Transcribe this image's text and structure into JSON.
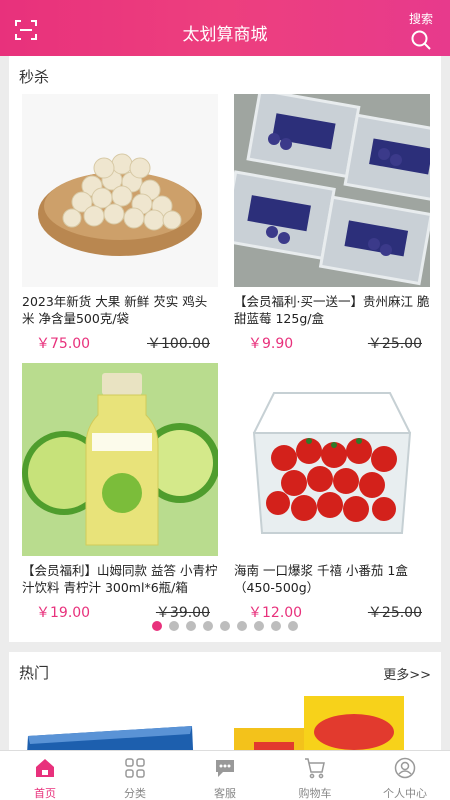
{
  "header": {
    "title": "太划算商城",
    "search_label": "搜索",
    "scan_icon": "scan-icon",
    "search_icon": "search-icon"
  },
  "flash_sale": {
    "title": "秒杀",
    "products": [
      {
        "name": "2023年新货 大果 新鲜 芡实 鸡头米 净含量500克/袋",
        "price": "￥75.00",
        "old_price": "￥100.00"
      },
      {
        "name": "【会员福利·买一送一】贵州麻江 脆甜蓝莓 125g/盒",
        "price": "￥9.90",
        "old_price": "￥25.00"
      },
      {
        "name": "【会员福利】山姆同款 益答 小青柠汁饮料 青柠汁 300ml*6瓶/箱",
        "price": "￥19.00",
        "old_price": "￥39.00"
      },
      {
        "name": "海南 一口爆浆 千禧 小番茄 1盒（450-500g）",
        "price": "￥12.00",
        "old_price": "￥25.00"
      }
    ],
    "pagination": {
      "total": 9,
      "active": 1
    }
  },
  "hot": {
    "title": "热门",
    "more_label": "更多>>"
  },
  "tabbar": {
    "items": [
      {
        "label": "首页",
        "icon": "home-icon",
        "active": true
      },
      {
        "label": "分类",
        "icon": "grid-icon",
        "active": false
      },
      {
        "label": "客服",
        "icon": "chat-icon",
        "active": false
      },
      {
        "label": "购物车",
        "icon": "cart-icon",
        "active": false
      },
      {
        "label": "个人中心",
        "icon": "user-icon",
        "active": false
      }
    ]
  },
  "colors": {
    "accent": "#e8317c",
    "inactive": "#888888"
  }
}
